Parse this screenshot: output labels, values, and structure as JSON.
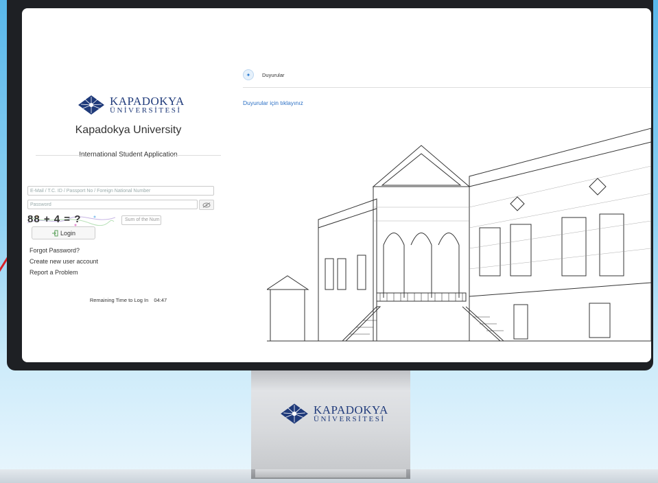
{
  "login": {
    "logo_line1": "KAPADOKYA",
    "logo_line2": "ÜNİVERSİTESİ",
    "university": "Kapadokya University",
    "application": "International Student Application",
    "username_placeholder": "E-Mail / T.C. ID / Passport No / Foreign National Number",
    "password_placeholder": "Password",
    "captcha_text": "88 + 4 = ?",
    "captcha_placeholder": "Sum of the Num",
    "login_label": "Login",
    "forgot_password": "Forgot Password?",
    "create_account": "Create new user account",
    "report_problem": "Report a Problem",
    "timer_label": "Remaining Time to Log In",
    "timer_value": "04:47"
  },
  "announcements": {
    "title": "Duyurular",
    "link": "Duyurular için tıklayınız"
  },
  "stand": {
    "logo_line1": "KAPADOKYA",
    "logo_line2": "ÜNİVERSİTESİ"
  },
  "colors": {
    "brand_navy": "#1f3a7a",
    "link_blue": "#2a6fc4",
    "background_blue": "#59b7ea"
  }
}
